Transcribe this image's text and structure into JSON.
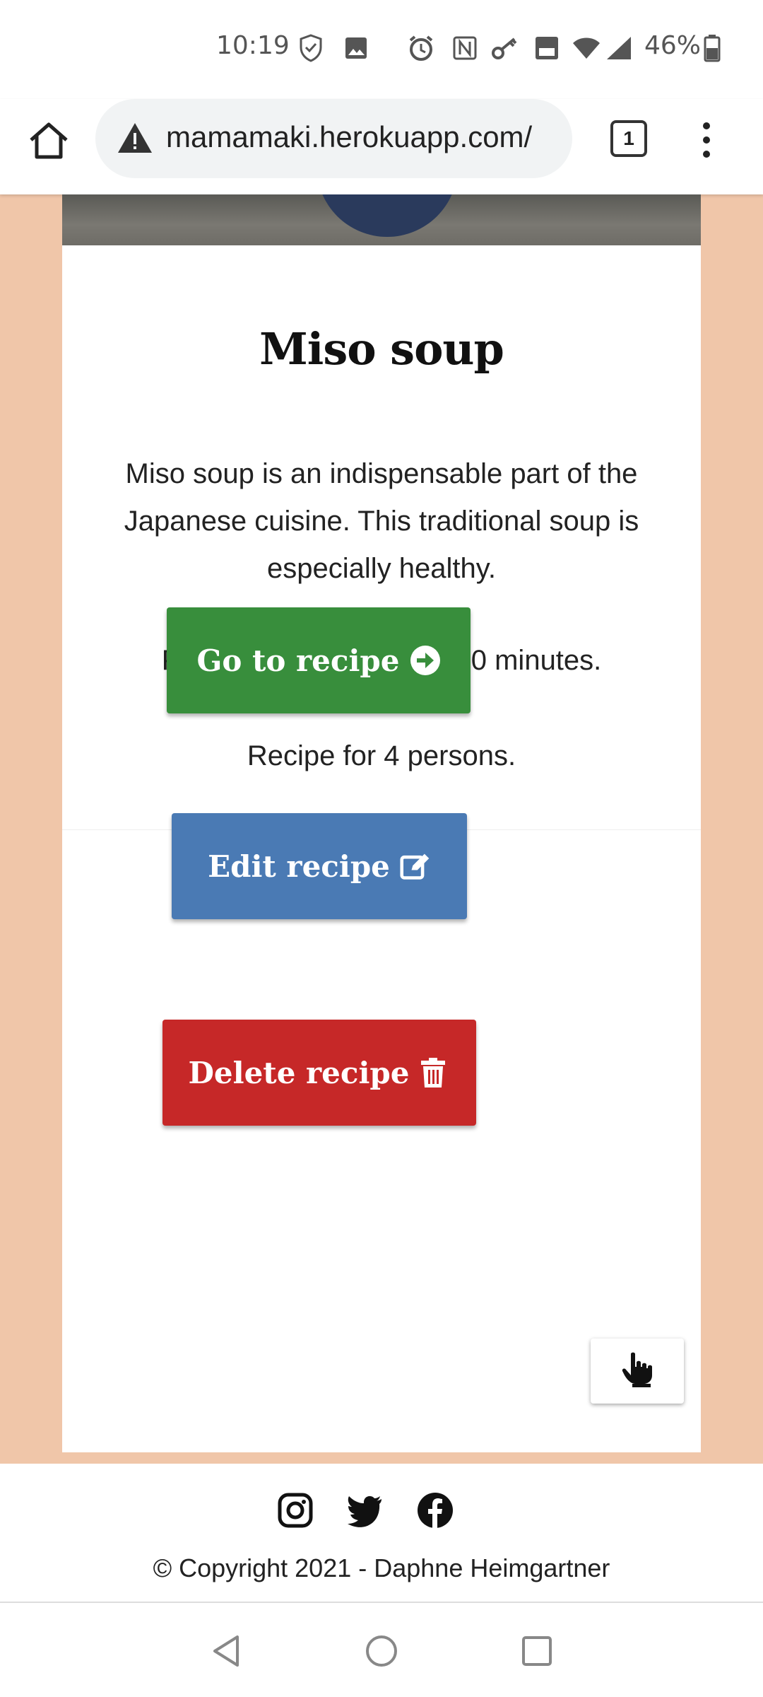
{
  "status_bar": {
    "time": "10:19",
    "battery": "46%",
    "icons": [
      "shield-icon",
      "image-icon",
      "alarm-icon",
      "nfc-icon",
      "key-icon",
      "volte-icon",
      "wifi-icon",
      "signal-icon",
      "battery-icon"
    ]
  },
  "browser": {
    "url": "mamamaki.herokuapp.com/",
    "tab_count": "1",
    "icons": [
      "home-icon",
      "warning-icon",
      "more-vert-icon"
    ]
  },
  "recipe": {
    "title": "Miso soup",
    "description": "Miso soup is an indispensable part of the Japanese cuisine. This traditional soup is especially healthy.",
    "prep_time": "Preparation time about 10 minutes.",
    "persons": "Recipe for 4 persons."
  },
  "actions": {
    "go_label": "Go to recipe",
    "edit_label": "Edit recipe",
    "delete_label": "Delete recipe",
    "go_icon": "arrow-circle-right-icon",
    "edit_icon": "edit-icon",
    "delete_icon": "trash-icon",
    "scroll_icon": "hand-pointer-icon"
  },
  "footer": {
    "social": [
      "instagram-icon",
      "twitter-icon",
      "facebook-icon"
    ],
    "copyright": "© Copyright 2021 - Daphne Heimgartner"
  },
  "colors": {
    "page_bg": "#f0c6a9",
    "go_button": "#388e3c",
    "edit_button": "#4a7ab4",
    "delete_button": "#c62828"
  }
}
